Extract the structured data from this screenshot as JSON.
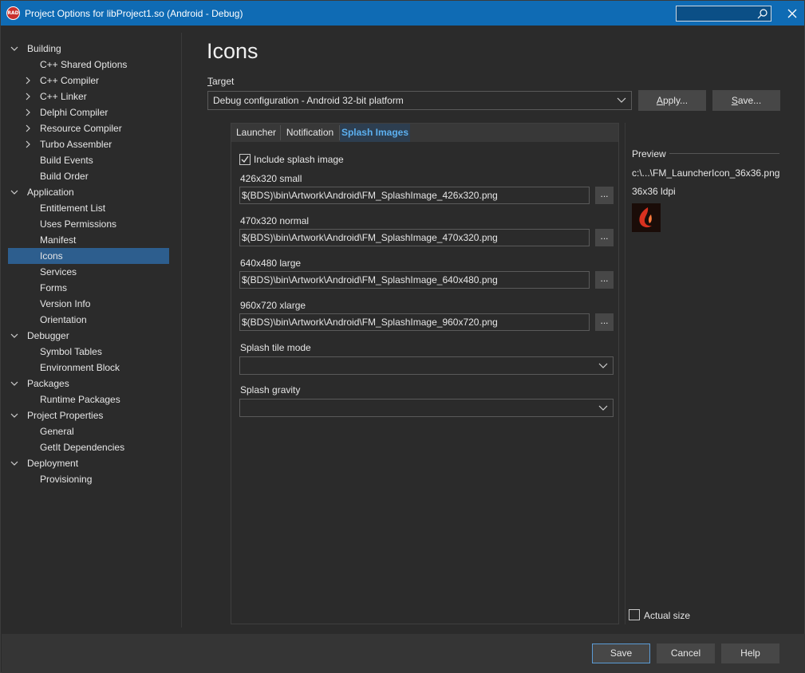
{
  "window": {
    "title": "Project Options for libProject1.so  (Android - Debug)",
    "app_icon_text": "RAD",
    "search_placeholder": ""
  },
  "sidebar": {
    "items": [
      {
        "label": "Building",
        "level": 0,
        "expanded": true
      },
      {
        "label": "C++ Shared Options",
        "level": 1
      },
      {
        "label": "C++ Compiler",
        "level": 1,
        "collapsed": true
      },
      {
        "label": "C++ Linker",
        "level": 1,
        "collapsed": true
      },
      {
        "label": "Delphi Compiler",
        "level": 1,
        "collapsed": true
      },
      {
        "label": "Resource Compiler",
        "level": 1,
        "collapsed": true
      },
      {
        "label": "Turbo Assembler",
        "level": 1,
        "collapsed": true
      },
      {
        "label": "Build Events",
        "level": 1
      },
      {
        "label": "Build Order",
        "level": 1
      },
      {
        "label": "Application",
        "level": 0,
        "expanded": true
      },
      {
        "label": "Entitlement List",
        "level": 1
      },
      {
        "label": "Uses Permissions",
        "level": 1
      },
      {
        "label": "Manifest",
        "level": 1
      },
      {
        "label": "Icons",
        "level": 1,
        "selected": true
      },
      {
        "label": "Services",
        "level": 1
      },
      {
        "label": "Forms",
        "level": 1
      },
      {
        "label": "Version Info",
        "level": 1
      },
      {
        "label": "Orientation",
        "level": 1
      },
      {
        "label": "Debugger",
        "level": 0,
        "expanded": true
      },
      {
        "label": "Symbol Tables",
        "level": 1
      },
      {
        "label": "Environment Block",
        "level": 1
      },
      {
        "label": "Packages",
        "level": 0,
        "expanded": true
      },
      {
        "label": "Runtime Packages",
        "level": 1
      },
      {
        "label": "Project Properties",
        "level": 0,
        "expanded": true
      },
      {
        "label": "General",
        "level": 1
      },
      {
        "label": "GetIt Dependencies",
        "level": 1
      },
      {
        "label": "Deployment",
        "level": 0,
        "expanded": true
      },
      {
        "label": "Provisioning",
        "level": 1
      }
    ]
  },
  "main": {
    "title": "Icons",
    "target_label_accel": "T",
    "target_label_rest": "arget",
    "target_value": "Debug configuration - Android 32-bit platform",
    "apply_accel": "A",
    "apply_rest": "pply...",
    "save_accel": "S",
    "save_rest": "ave..."
  },
  "tabs": [
    {
      "label": "Launcher",
      "active": false
    },
    {
      "label": "Notification",
      "active": false
    },
    {
      "label": "Splash Images",
      "active": true
    }
  ],
  "splash": {
    "include_label": "Include splash image",
    "include_checked": true,
    "images": [
      {
        "label": "426x320 small",
        "value": "$(BDS)\\bin\\Artwork\\Android\\FM_SplashImage_426x320.png",
        "browse": "..."
      },
      {
        "label": "470x320 normal",
        "value": "$(BDS)\\bin\\Artwork\\Android\\FM_SplashImage_470x320.png",
        "browse": "..."
      },
      {
        "label": "640x480 large",
        "value": "$(BDS)\\bin\\Artwork\\Android\\FM_SplashImage_640x480.png",
        "browse": "..."
      },
      {
        "label": "960x720 xlarge",
        "value": "$(BDS)\\bin\\Artwork\\Android\\FM_SplashImage_960x720.png",
        "browse": "..."
      }
    ],
    "tile_mode_label": "Splash tile mode",
    "tile_mode_value": "",
    "gravity_label": "Splash gravity",
    "gravity_value": ""
  },
  "preview": {
    "title": "Preview",
    "path": "c:\\...\\FM_LauncherIcon_36x36.png",
    "dpi": "36x36 ldpi",
    "actual_size_label": "Actual size",
    "actual_size_checked": false
  },
  "footer": {
    "save": "Save",
    "cancel": "Cancel",
    "help": "Help"
  },
  "colors": {
    "titlebar": "#0f6bb4",
    "selection": "#2d5e8e",
    "active_tab_text": "#5cb0f0",
    "background": "#2b2b2b"
  }
}
